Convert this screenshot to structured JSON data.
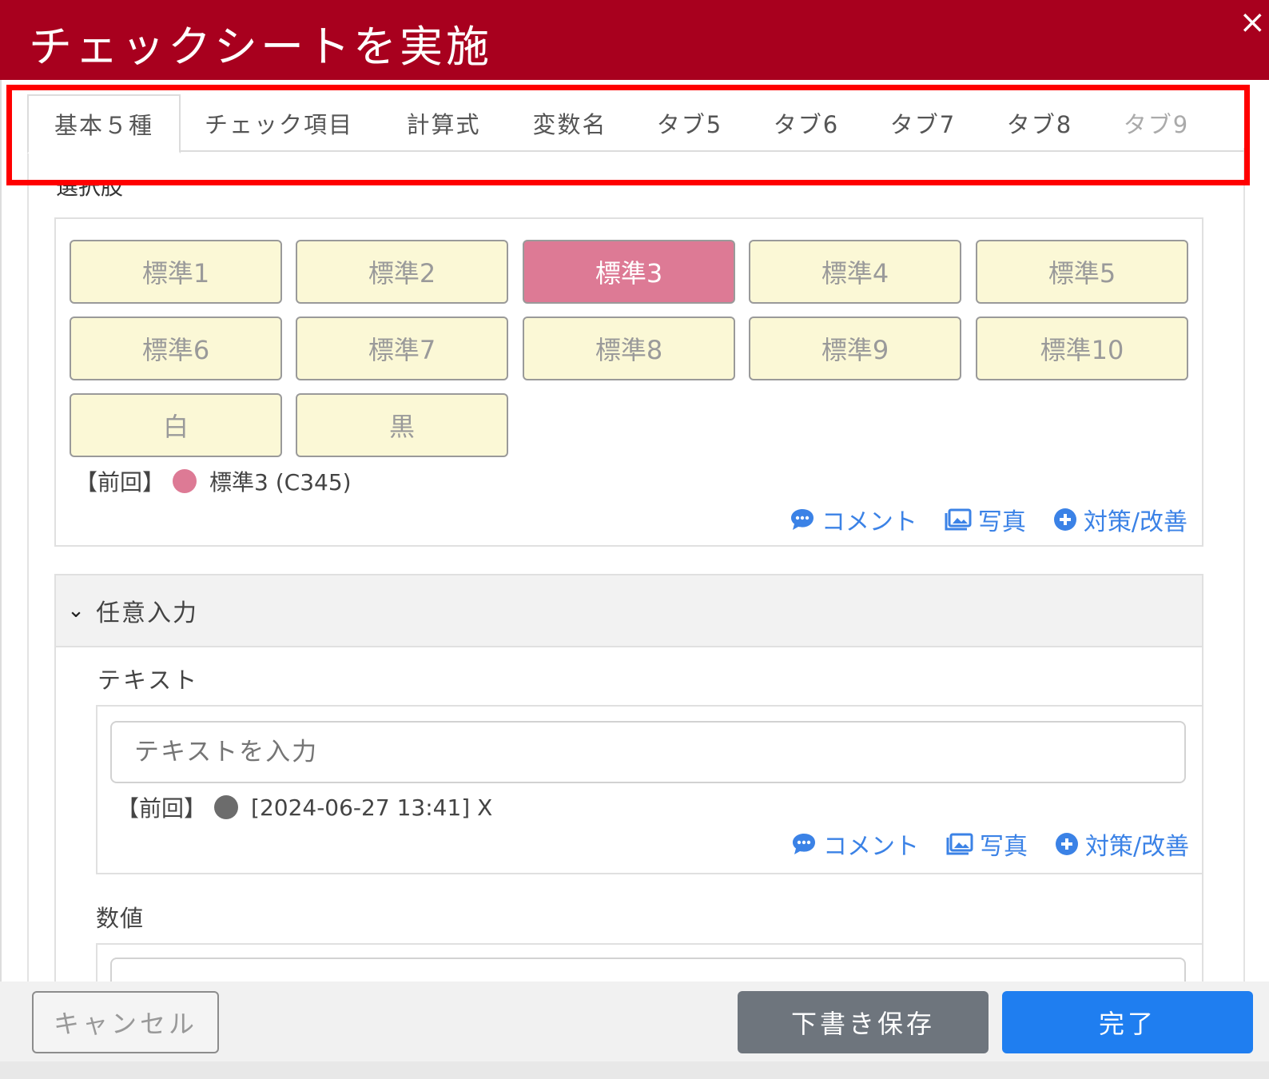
{
  "dialog": {
    "title": "チェックシートを実施",
    "close_symbol": "×"
  },
  "tabs": [
    {
      "label": "基本５種",
      "active": true
    },
    {
      "label": "チェック項目"
    },
    {
      "label": "計算式"
    },
    {
      "label": "変数名"
    },
    {
      "label": "タブ5"
    },
    {
      "label": "タブ6"
    },
    {
      "label": "タブ7"
    },
    {
      "label": "タブ8"
    },
    {
      "label": "タブ9"
    }
  ],
  "selection": {
    "label": "選択肢",
    "options": [
      "標準1",
      "標準2",
      "標準3",
      "標準4",
      "標準5",
      "標準6",
      "標準7",
      "標準8",
      "標準9",
      "標準10",
      "白",
      "黒"
    ],
    "selected": "標準3",
    "previous": {
      "prefix": "【前回】",
      "value": "標準3 (C345)",
      "dot_color": "#dd7a95"
    }
  },
  "actions": {
    "comment": "コメント",
    "photo": "写真",
    "measure": "対策/改善"
  },
  "optional_section": {
    "title": "任意入力",
    "text_field": {
      "label": "テキスト",
      "placeholder": "テキストを入力",
      "previous": {
        "prefix": "【前回】",
        "value": "[2024-06-27 13:41] X",
        "dot_color": "#6c6c6c"
      }
    },
    "number_field": {
      "label": "数値"
    }
  },
  "footer": {
    "cancel": "キャンセル",
    "save_draft": "下書き保存",
    "complete": "完了"
  },
  "colors": {
    "header": "#a8001e",
    "selected_option": "#dd7a95",
    "option_bg": "#fbf8d6",
    "link": "#3b82e6",
    "primary": "#1f7ef0",
    "secondary": "#6e757d"
  }
}
